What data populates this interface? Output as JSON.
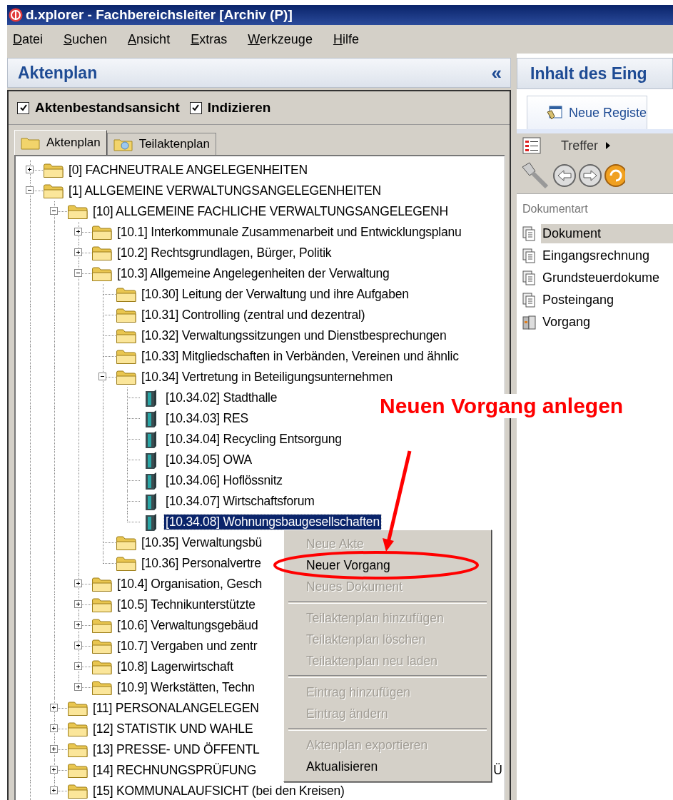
{
  "window": {
    "title": "d.xplorer - Fachbereichsleiter [Archiv (P)]"
  },
  "menu_bar": [
    "Datei",
    "Suchen",
    "Ansicht",
    "Extras",
    "Werkzeuge",
    "Hilfe"
  ],
  "left_panel": {
    "title": "Aktenplan",
    "collapse": "«",
    "options": [
      {
        "label": "Aktenbestandsansicht",
        "checked": true
      },
      {
        "label": "Indizieren",
        "checked": true
      }
    ],
    "tabs": [
      {
        "label": "Aktenplan",
        "selected": true
      },
      {
        "label": "Teilaktenplan",
        "selected": false
      }
    ]
  },
  "tree": {
    "items": [
      {
        "label": "[0] FACHNEUTRALE  ANGELEGENHEITEN",
        "kind": "folder",
        "expanded": false,
        "selected": false
      },
      {
        "label": "[1] ALLGEMEINE VERWALTUNGSANGELEGENHEITEN",
        "kind": "folder",
        "expanded": true,
        "selected": false,
        "children": [
          {
            "label": "[10] ALLGEMEINE  FACHLICHE VERWALTUNGSANGELEGENH",
            "kind": "folder",
            "expanded": true,
            "selected": false,
            "children": [
              {
                "label": "[10.1] Interkommunale Zusammenarbeit und Entwicklungsplanu",
                "kind": "folder",
                "expanded": false,
                "selected": false
              },
              {
                "label": "[10.2] Rechtsgrundlagen,  Bürger, Politik",
                "kind": "folder",
                "expanded": false,
                "selected": false
              },
              {
                "label": "[10.3] Allgemeine Angelegenheiten der Verwaltung",
                "kind": "folder",
                "expanded": true,
                "selected": false,
                "children": [
                  {
                    "label": "[10.30] Leitung der Verwaltung und ihre Aufgaben",
                    "kind": "folder",
                    "selected": false
                  },
                  {
                    "label": "[10.31] Controlling (zentral und dezentral)",
                    "kind": "folder",
                    "selected": false
                  },
                  {
                    "label": "[10.32] Verwaltungssitzungen und Dienstbesprechungen",
                    "kind": "folder",
                    "selected": false
                  },
                  {
                    "label": "[10.33] Mitgliedschaften in Verbänden, Vereinen und ähnlic",
                    "kind": "folder",
                    "selected": false
                  },
                  {
                    "label": "[10.34] Vertretung in Beteiligungsunternehmen",
                    "kind": "folder",
                    "expanded": true,
                    "selected": false,
                    "children": [
                      {
                        "label": "[10.34.02] Stadthalle",
                        "kind": "file",
                        "selected": false
                      },
                      {
                        "label": "[10.34.03] RES",
                        "kind": "file",
                        "selected": false
                      },
                      {
                        "label": "[10.34.04] Recycling Entsorgung",
                        "kind": "file",
                        "selected": false
                      },
                      {
                        "label": "[10.34.05] OWA",
                        "kind": "file",
                        "selected": false
                      },
                      {
                        "label": "[10.34.06] Hoflössnitz",
                        "kind": "file",
                        "selected": false
                      },
                      {
                        "label": "[10.34.07] Wirtschaftsforum",
                        "kind": "file",
                        "selected": false
                      },
                      {
                        "label": "[10.34.08] Wohnungsbaugesellschaften",
                        "kind": "file",
                        "selected": true
                      }
                    ]
                  },
                  {
                    "label": "[10.35] Verwaltungsbü",
                    "kind": "folder",
                    "selected": false
                  },
                  {
                    "label": "[10.36] Personalvertre",
                    "kind": "folder",
                    "selected": false
                  }
                ]
              },
              {
                "label": "[10.4] Organisation, Gesch",
                "kind": "folder",
                "expanded": false,
                "selected": false
              },
              {
                "label": "[10.5] Technikunterstützte",
                "kind": "folder",
                "expanded": false,
                "selected": false
              },
              {
                "label": "[10.6] Verwaltungsgebäud",
                "kind": "folder",
                "expanded": false,
                "selected": false
              },
              {
                "label": "[10.7] Vergaben und zentr",
                "kind": "folder",
                "expanded": false,
                "selected": false
              },
              {
                "label": "[10.8] Lagerwirtschaft",
                "kind": "folder",
                "expanded": false,
                "selected": false
              },
              {
                "label": "[10.9] Werkstätten, Techn",
                "kind": "folder",
                "expanded": false,
                "selected": false
              }
            ]
          },
          {
            "label": "[11] PERSONALANGELEGEN",
            "kind": "folder",
            "expanded": false,
            "selected": false
          },
          {
            "label": "[12] STATISTIK UND WAHLE",
            "kind": "folder",
            "expanded": false,
            "selected": false
          },
          {
            "label": "[13] PRESSE- UND ÖFFENTL",
            "kind": "folder",
            "expanded": false,
            "selected": false
          },
          {
            "label": "[14] RECHNUNGSPRÜFUNG",
            "kind": "folder",
            "expanded": false,
            "selected": false,
            "tail": "Ü"
          },
          {
            "label": "[15] KOMMUNALAUFSICHT (bei den Kreisen)",
            "kind": "folder",
            "expanded": false,
            "selected": false
          }
        ]
      }
    ]
  },
  "context_menu": [
    {
      "kind": "item",
      "label": "Neue Akte",
      "disabled": true
    },
    {
      "kind": "item",
      "label": "Neuer Vorgang",
      "disabled": false
    },
    {
      "kind": "item",
      "label": "Neues Dokument",
      "disabled": true
    },
    {
      "kind": "separator"
    },
    {
      "kind": "item",
      "label": "Teilaktenplan hinzufügen",
      "disabled": true
    },
    {
      "kind": "item",
      "label": "Teilaktenplan löschen",
      "disabled": true
    },
    {
      "kind": "item",
      "label": "Teilaktenplan neu laden",
      "disabled": true
    },
    {
      "kind": "separator"
    },
    {
      "kind": "item",
      "label": "Eintrag hinzufügen",
      "disabled": true
    },
    {
      "kind": "item",
      "label": "Eintrag ändern",
      "disabled": true
    },
    {
      "kind": "separator"
    },
    {
      "kind": "item",
      "label": "Aktenplan exportieren",
      "disabled": true
    },
    {
      "kind": "item",
      "label": "Aktualisieren",
      "disabled": false
    }
  ],
  "right_panel": {
    "title": "Inhalt des Eing",
    "tab": "Neue Registe",
    "hits": "Treffer",
    "list_heading": "Dokumentart",
    "list": [
      {
        "label": "Dokument",
        "kind": "document",
        "selected": true
      },
      {
        "label": "Eingangsrechnung",
        "kind": "document",
        "selected": false
      },
      {
        "label": "Grundsteuerdokume",
        "kind": "document",
        "selected": false
      },
      {
        "label": "Posteingang",
        "kind": "document",
        "selected": false
      },
      {
        "label": "Vorgang",
        "kind": "case",
        "selected": false
      }
    ]
  },
  "annotation": {
    "text": "Neuen Vorgang anlegen"
  }
}
